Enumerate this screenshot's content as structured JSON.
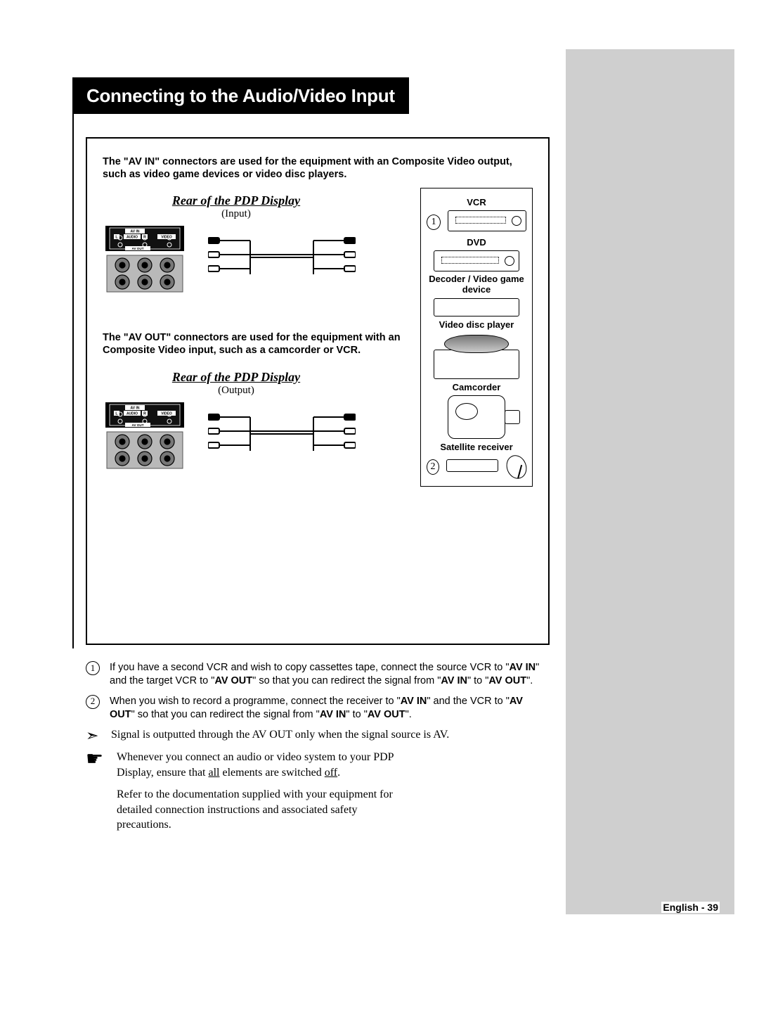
{
  "title": "Connecting to the Audio/Video Input",
  "intro_avin": "The \"AV IN\" connectors are used for the equipment with an Composite Video output, such as video game devices or video disc players.",
  "intro_avout": "The \"AV OUT\" connectors are used for the equipment with an Composite Video input, such as a camcorder or VCR.",
  "rear_heading": "Rear of the PDP Display",
  "input_label": "(Input)",
  "output_label": "(Output)",
  "panel_labels": {
    "av_in": "AV IN",
    "audio_l": "L",
    "audio": "AUDIO",
    "audio_r": "R",
    "video": "VIDEO",
    "av_out": "AV OUT"
  },
  "devices": {
    "vcr": "VCR",
    "dvd": "DVD",
    "decoder": "Decoder / Video game device",
    "disc": "Video disc player",
    "camcorder": "Camcorder",
    "sat": "Satellite receiver"
  },
  "notes": {
    "n1_a": "If you have a second VCR and wish to copy cassettes tape, connect the source VCR to \"",
    "n1_b": "AV IN",
    "n1_c": "\" and the target VCR to \"",
    "n1_d": "AV OUT",
    "n1_e": "\" so that you can redirect the signal from \"",
    "n1_f": "AV IN",
    "n1_g": "\" to \"",
    "n1_h": "AV OUT",
    "n1_i": "\".",
    "n2_a": "When you wish to record a programme, connect the receiver to \"",
    "n2_b": "AV IN",
    "n2_c": "\" and the VCR to \"",
    "n2_d": "AV OUT",
    "n2_e": "\" so that you can redirect the signal from \"",
    "n2_f": "AV IN",
    "n2_g": "\" to \"",
    "n2_h": "AV OUT",
    "n2_i": "\".",
    "arrow_note": "Signal is outputted through the AV OUT only when the signal source is AV."
  },
  "advice": {
    "p1_a": "Whenever you connect an audio or video system to your PDP Display, ensure that ",
    "p1_u1": "all",
    "p1_b": " elements are switched ",
    "p1_u2": "off",
    "p1_c": ".",
    "p2": "Refer to the documentation supplied with your equipment for detailed connection instructions and associated safety precautions."
  },
  "page_number": "English - 39"
}
